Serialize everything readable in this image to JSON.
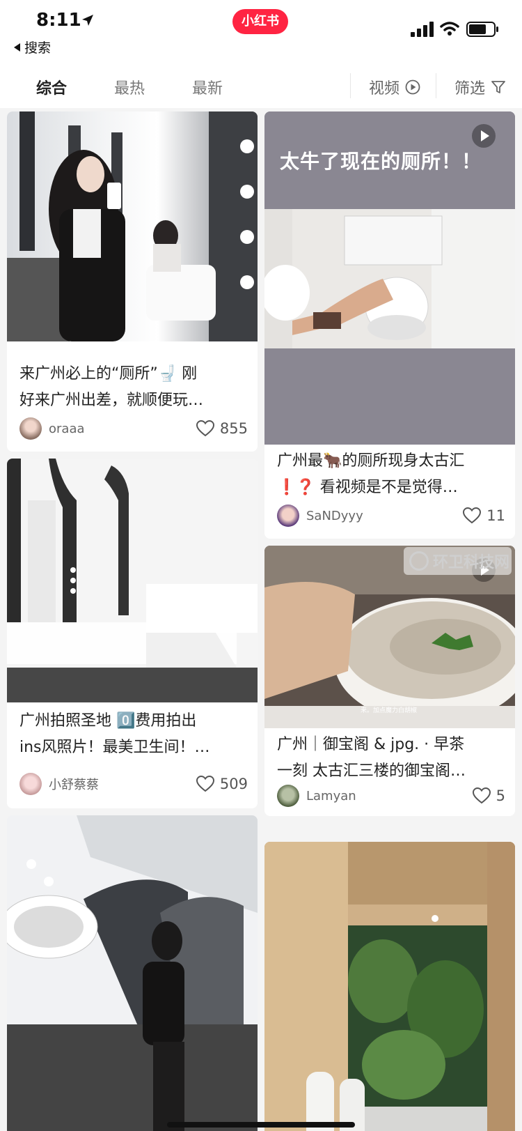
{
  "status": {
    "time": "8:11",
    "back_label": "搜索",
    "app_logo": "小红书"
  },
  "tabs": {
    "items": [
      "综合",
      "最热",
      "最新"
    ],
    "active": "综合",
    "video_label": "视频",
    "filter_label": "筛选"
  },
  "posts": [
    {
      "title_line1": "来广州必上的“厕所”🚽 刚",
      "title_line2": "好来广州出差，就顺便玩…",
      "author": "oraaa",
      "likes": "855"
    },
    {
      "banner": "太牛了现在的厕所！！",
      "title_line1": "广州最🐂的厕所现身太古汇",
      "title_line2": "❗❓ 看视频是不是觉得…",
      "author": "SaNDyyy",
      "likes": "11"
    },
    {
      "title_line1": "广州拍照圣地 0️⃣费用拍出",
      "title_line2": "ins风照片！最美卫生间！…",
      "author": "小舒蔡蔡",
      "likes": "509"
    },
    {
      "caption": "来。加点魔力白胡椒",
      "title_line1": "广州｜御宝阁 & jpg. · 早茶",
      "title_line2": "一刻 太古汇三楼的御宝阁…",
      "author": "Lamyan",
      "likes": "5"
    }
  ],
  "watermark": "环卫科技网",
  "colors": {
    "brand": "#ff2442",
    "video_banner": "#8a8792"
  }
}
